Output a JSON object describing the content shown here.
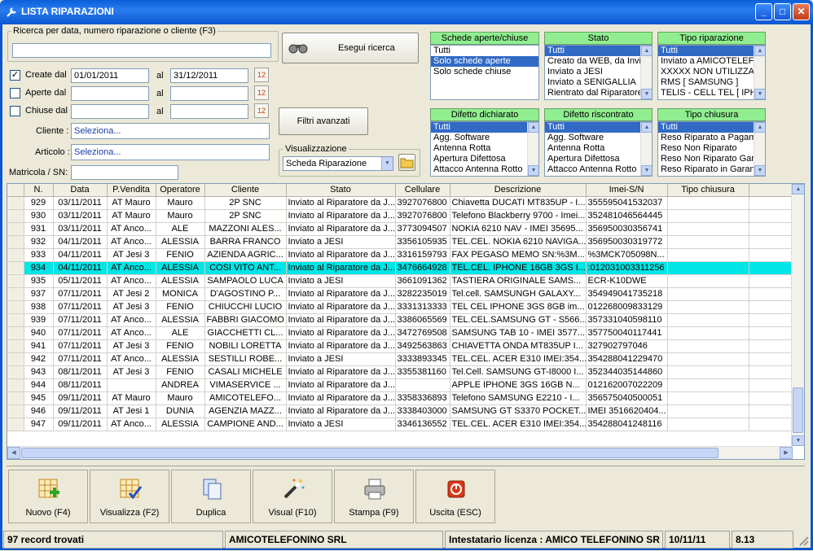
{
  "window": {
    "title": "LISTA RIPARAZIONI"
  },
  "search": {
    "group_label": "Ricerca per data, numero riparazione o cliente (F3)",
    "value": "",
    "button": "Esegui ricerca"
  },
  "date_filters": [
    {
      "label": "Create dal",
      "checked": true,
      "check_mark": "✓",
      "from": "01/01/2011",
      "to_label": "al",
      "to": "31/12/2011"
    },
    {
      "label": "Aperte dal",
      "checked": false,
      "check_mark": "",
      "from": "",
      "to_label": "al",
      "to": ""
    },
    {
      "label": "Chiuse dal",
      "checked": false,
      "check_mark": "",
      "from": "",
      "to_label": "al",
      "to": ""
    }
  ],
  "cliente": {
    "label": "Cliente :",
    "value": "Seleziona..."
  },
  "articolo": {
    "label": "Articolo :",
    "value": "Seleziona..."
  },
  "matricola": {
    "label": "Matricola / SN:",
    "value": ""
  },
  "filtri_avanzati": "Filtri avanzati",
  "visualizzazione": {
    "label": "Visualizzazione",
    "value": "Scheda Riparazione"
  },
  "listboxes": [
    {
      "header": "Schede aperte/chiuse",
      "items": [
        "Tutti",
        "Solo schede aperte",
        "Solo schede chiuse"
      ],
      "selected": 1,
      "scroll": false
    },
    {
      "header": "Stato",
      "items": [
        "Tutti",
        "Creato da WEB, da Invi",
        "Inviato a JESI",
        "Inviato a SENIGALLIA",
        "Rientrato dal Riparatore"
      ],
      "selected": 0,
      "scroll": true
    },
    {
      "header": "Tipo riparazione",
      "items": [
        "Tutti",
        "Inviato a AMICOTELEF",
        "XXXXX NON UTILIZZA",
        "RMS [ SAMSUNG ]",
        "TELIS - CELL TEL [ IPH"
      ],
      "selected": 0,
      "scroll": true
    },
    {
      "header": "Difetto dichiarato",
      "items": [
        "Tutti",
        "Agg. Software",
        "Antenna Rotta",
        "Apertura Difettosa",
        "Attacco Antenna Rotto"
      ],
      "selected": 0,
      "scroll": true
    },
    {
      "header": "Difetto riscontrato",
      "items": [
        "Tutti",
        "Agg. Software",
        "Antenna Rotta",
        "Apertura Difettosa",
        "Attacco Antenna Rotto"
      ],
      "selected": 0,
      "scroll": true
    },
    {
      "header": "Tipo chiusura",
      "items": [
        "Tutti",
        "Reso Riparato a Pagam",
        "Reso Non Riparato",
        "Reso Non Riparato Gar",
        "Reso Riparato in Garan"
      ],
      "selected": 0,
      "scroll": true
    }
  ],
  "grid": {
    "columns": [
      "N.",
      "Data",
      "P.Vendita",
      "Operatore",
      "Cliente",
      "Stato",
      "Cellulare",
      "Descrizione",
      "Imei-S/N",
      "Tipo chiusura"
    ],
    "highlight_index": 5,
    "rows": [
      [
        "929",
        "03/11/2011",
        "AT Mauro",
        "Mauro",
        "2P SNC",
        "Inviato al Riparatore da J...",
        "3927076800",
        "Chiavetta DUCATI MT835UP - I...",
        "355595041532037",
        ""
      ],
      [
        "930",
        "03/11/2011",
        "AT Mauro",
        "Mauro",
        "2P SNC",
        "Inviato al Riparatore da J...",
        "3927076800",
        "Telefono Blackberry 9700 - Imei...",
        "352481046564445",
        ""
      ],
      [
        "931",
        "03/11/2011",
        "AT Anco...",
        "ALE",
        "MAZZONI ALES...",
        "Inviato al Riparatore da J...",
        "3773094507",
        "NOKIA 6210 NAV - IMEI 35695...",
        "356950030356741",
        ""
      ],
      [
        "932",
        "04/11/2011",
        "AT Anco...",
        "ALESSIA",
        "BARRA FRANCO",
        "Inviato a JESI",
        "3356105935",
        "TEL.CEL. NOKIA 6210 NAVIGA...",
        "356950030319772",
        ""
      ],
      [
        "933",
        "04/11/2011",
        "AT Jesi 3",
        "FENIO",
        "AZIENDA AGRIC...",
        "Inviato al Riparatore da J...",
        "3316159793",
        "FAX PEGASO MEMO SN:%3M...",
        "%3MCK705098N...",
        ""
      ],
      [
        "934",
        "04/11/2011",
        "AT Anco...",
        "ALESSIA",
        "COSI VITO ANT...",
        "Inviato al Riparatore da J...",
        "3476664928",
        "TEL.CEL. IPHONE 16GB 3GS I...",
        ":012031003311256",
        ""
      ],
      [
        "935",
        "05/11/2011",
        "AT Anco...",
        "ALESSIA",
        "SAMPAOLO LUCA",
        "Inviato a JESI",
        "3661091362",
        "TASTIERA ORIGINALE SAMS...",
        "ECR-K10DWE",
        ""
      ],
      [
        "937",
        "07/11/2011",
        "AT Jesi 2",
        "MONICA",
        "D'AGOSTINO P...",
        "Inviato al Riparatore da J...",
        "3282235019",
        "Tel.cell. SAMSUNGH GALAXY...",
        "354949041735218",
        ""
      ],
      [
        "938",
        "07/11/2011",
        "AT Jesi 3",
        "FENIO",
        "CHIUCCHI LUCIO",
        "Inviato al Riparatore da J...",
        "3331313333",
        "TEL CEL IPHONE 3GS 8GB im...",
        "012268009833129",
        ""
      ],
      [
        "939",
        "07/11/2011",
        "AT Anco...",
        "ALESSIA",
        "FABBRI GIACOMO",
        "Inviato al Riparatore da J...",
        "3386065569",
        "TEL.CEL.SAMSUNG GT - S566...",
        "357331040598110",
        ""
      ],
      [
        "940",
        "07/11/2011",
        "AT Anco...",
        "ALE",
        "GIACCHETTI CL...",
        "Inviato al Riparatore da J...",
        "3472769508",
        "SAMSUNG TAB 10 - IMEI 3577...",
        "357750040117441",
        ""
      ],
      [
        "941",
        "07/11/2011",
        "AT Jesi 3",
        "FENIO",
        "NOBILI LORETTA",
        "Inviato al Riparatore da J...",
        "3492563863",
        "CHIAVETTA ONDA MT835UP I...",
        "327902797046",
        ""
      ],
      [
        "942",
        "07/11/2011",
        "AT Anco...",
        "ALESSIA",
        "SESTILLI ROBE...",
        "Inviato a JESI",
        "3333893345",
        "TEL.CEL. ACER E310 IMEI:354...",
        "354288041229470",
        ""
      ],
      [
        "943",
        "08/11/2011",
        "AT Jesi 3",
        "FENIO",
        "CASALI MICHELE",
        "Inviato al Riparatore da J...",
        "3355381160",
        "Tel.Cell. SAMSUNG GT-I8000 I...",
        "352344035144860",
        ""
      ],
      [
        "944",
        "08/11/2011",
        "",
        "ANDREA",
        "VIMASERVICE ...",
        "Inviato al Riparatore da J...",
        "",
        "APPLE IPHONE 3GS 16GB  N...",
        "012162007022209",
        ""
      ],
      [
        "945",
        "09/11/2011",
        "AT Mauro",
        "Mauro",
        "AMICOTELEFO...",
        "Inviato al Riparatore da J...",
        "3358336893",
        "Telefono SAMSUNG E2210 - I...",
        "356575040500051",
        ""
      ],
      [
        "946",
        "09/11/2011",
        "AT Jesi 1",
        "DUNIA",
        "AGENZIA MAZZ...",
        "Inviato al Riparatore da J...",
        "3338403000",
        "SAMSUNG GT S3370 POCKET...",
        "IMEI 3516620404...",
        ""
      ],
      [
        "947",
        "09/11/2011",
        "AT Anco...",
        "ALESSIA",
        "CAMPIONE AND...",
        "Inviato a JESI",
        "3346136552",
        "TEL.CEL. ACER E310 IMEI:354...",
        "354288041248116",
        ""
      ]
    ]
  },
  "toolbar": [
    {
      "label": "Nuovo (F4)",
      "icon": "new-record-icon"
    },
    {
      "label": "Visualizza (F2)",
      "icon": "view-record-icon"
    },
    {
      "label": "Duplica",
      "icon": "duplicate-icon"
    },
    {
      "label": "Visual (F10)",
      "icon": "magic-wand-icon"
    },
    {
      "label": "Stampa (F9)",
      "icon": "printer-icon"
    },
    {
      "label": "Uscita (ESC)",
      "icon": "exit-icon"
    }
  ],
  "status": {
    "records": "97 record trovati",
    "company": "AMICOTELEFONINO SRL",
    "license": "Intestatario licenza : AMICO TELEFONINO SR",
    "date": "10/11/11",
    "version": "8.13"
  },
  "colors": {
    "titlebar": "#0b57cf",
    "listbox_header": "#90ee90",
    "selection": "#316ac5",
    "row_highlight": "#00e5e5"
  }
}
